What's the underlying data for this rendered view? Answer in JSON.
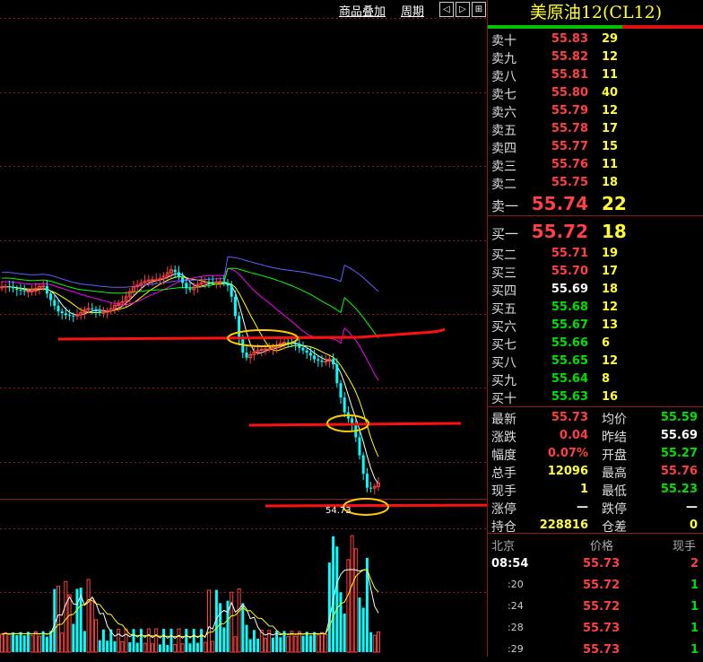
{
  "toolbar": {
    "overlay_label": "商品叠加",
    "period_label": "周期",
    "nav_left": "◁",
    "nav_right": "▷",
    "nav_expand": "⊞"
  },
  "chart": {
    "last_low_label": "54.73"
  },
  "colors": {
    "up": "#ff4040",
    "down": "#00ffff",
    "ma5": "#ffffff",
    "ma10": "#ffff00",
    "ma20": "#ff00ff",
    "ma60": "#00ff00",
    "ma_long": "#6060ff",
    "annotation": "#ff1010",
    "circle": "#ffcc00",
    "grid": "#8c1a1a"
  },
  "title": "美原油12(CL12)",
  "asks": [
    {
      "label": "卖十",
      "price": "55.83",
      "vol": "29"
    },
    {
      "label": "卖九",
      "price": "55.82",
      "vol": "12"
    },
    {
      "label": "卖八",
      "price": "55.81",
      "vol": "11"
    },
    {
      "label": "卖七",
      "price": "55.80",
      "vol": "40"
    },
    {
      "label": "卖六",
      "price": "55.79",
      "vol": "12"
    },
    {
      "label": "卖五",
      "price": "55.78",
      "vol": "17"
    },
    {
      "label": "卖四",
      "price": "55.77",
      "vol": "15"
    },
    {
      "label": "卖三",
      "price": "55.76",
      "vol": "11"
    },
    {
      "label": "卖二",
      "price": "55.75",
      "vol": "18"
    }
  ],
  "ask1": {
    "label": "卖一",
    "price": "55.74",
    "vol": "22"
  },
  "bid1": {
    "label": "买一",
    "price": "55.72",
    "vol": "18"
  },
  "bids": [
    {
      "label": "买二",
      "price": "55.71",
      "vol": "19",
      "color": "#ff4040"
    },
    {
      "label": "买三",
      "price": "55.70",
      "vol": "17",
      "color": "#ff4040"
    },
    {
      "label": "买四",
      "price": "55.69",
      "vol": "18",
      "color": "#ffffff"
    },
    {
      "label": "买五",
      "price": "55.68",
      "vol": "12",
      "color": "#00e000"
    },
    {
      "label": "买六",
      "price": "55.67",
      "vol": "13",
      "color": "#00e000"
    },
    {
      "label": "买七",
      "price": "55.66",
      "vol": "6",
      "color": "#00e000"
    },
    {
      "label": "买八",
      "price": "55.65",
      "vol": "12",
      "color": "#00e000"
    },
    {
      "label": "买九",
      "price": "55.64",
      "vol": "8",
      "color": "#00e000"
    },
    {
      "label": "买十",
      "price": "55.63",
      "vol": "16",
      "color": "#00e000"
    }
  ],
  "stats": [
    {
      "l1": "最新",
      "v1": "55.73",
      "c1": "#ff4040",
      "l2": "均价",
      "v2": "55.59",
      "c2": "#00e000"
    },
    {
      "l1": "涨跌",
      "v1": "0.04",
      "c1": "#ff4040",
      "l2": "昨结",
      "v2": "55.69",
      "c2": "#ffffff"
    },
    {
      "l1": "幅度",
      "v1": "0.07%",
      "c1": "#ff4040",
      "l2": "开盘",
      "v2": "55.27",
      "c2": "#00e000"
    },
    {
      "l1": "总手",
      "v1": "12096",
      "c1": "#ffff33",
      "l2": "最高",
      "v2": "55.76",
      "c2": "#ff4040"
    },
    {
      "l1": "现手",
      "v1": "1",
      "c1": "#ffff33",
      "l2": "最低",
      "v2": "55.23",
      "c2": "#00e000"
    },
    {
      "l1": "涨停",
      "v1": "—",
      "c1": "#ffffff",
      "l2": "跌停",
      "v2": "—",
      "c2": "#ffffff"
    },
    {
      "l1": "持仓",
      "v1": "228816",
      "c1": "#ffff33",
      "l2": "仓差",
      "v2": "0",
      "c2": "#ffff33"
    }
  ],
  "ticks_header": {
    "time": "北京",
    "price": "价格",
    "vol": "现手"
  },
  "ticks": [
    {
      "time": "08:54",
      "price": "55.73",
      "vol": "2",
      "vcolor": "#ff4040"
    },
    {
      "time": ":20",
      "price": "55.72",
      "vol": "1",
      "vcolor": "#00e000"
    },
    {
      "time": ":24",
      "price": "55.72",
      "vol": "1",
      "vcolor": "#00e000"
    },
    {
      "time": ":28",
      "price": "55.73",
      "vol": "1",
      "vcolor": "#00e000"
    },
    {
      "time": ":29",
      "price": "55.73",
      "vol": "1",
      "vcolor": "#00e000"
    }
  ]
}
